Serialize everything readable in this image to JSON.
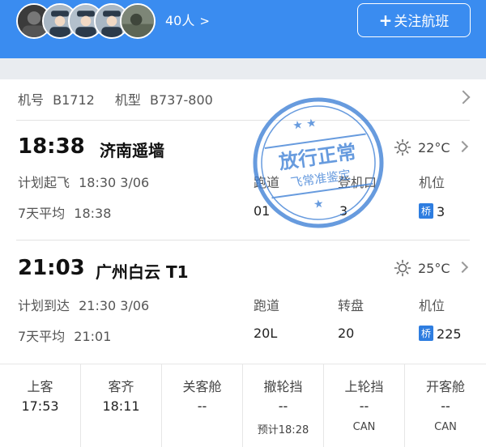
{
  "header": {
    "passenger_count": "40人",
    "passenger_chevron": ">",
    "follow_button_plus": "+",
    "follow_button_label": "关注航班"
  },
  "aircraft": {
    "reg_label": "机号",
    "reg_value": "B1712",
    "type_label": "机型",
    "type_value": "B737-800"
  },
  "departure": {
    "actual_time": "18:38",
    "airport": "济南遥墙",
    "weather_icon": "sun-icon",
    "temperature": "22°C",
    "planned_label": "计划起飞",
    "planned_time": "18:30 3/06",
    "avg_label": "7天平均",
    "avg_time": "18:38",
    "runway_label": "跑道",
    "runway_value": "01",
    "gate_label": "登机口",
    "gate_value": "3",
    "stand_label": "机位",
    "stand_badge": "桥",
    "stand_value": "3"
  },
  "arrival": {
    "actual_time": "21:03",
    "airport": "广州白云 T1",
    "weather_icon": "sun-icon",
    "temperature": "25°C",
    "planned_label": "计划到达",
    "planned_time": "21:30 3/06",
    "avg_label": "7天平均",
    "avg_time": "21:01",
    "runway_label": "跑道",
    "runway_value": "20L",
    "carousel_label": "转盘",
    "carousel_value": "20",
    "stand_label": "机位",
    "stand_badge": "桥",
    "stand_value": "225"
  },
  "stamp": {
    "top_text": "放行正常",
    "bottom_text": "飞常准鉴定",
    "color": "#3d7fd6"
  },
  "stages": [
    {
      "label": "上客",
      "time": "17:53",
      "sub": ""
    },
    {
      "label": "客齐",
      "time": "18:11",
      "sub": ""
    },
    {
      "label": "关客舱",
      "time": "--",
      "sub": ""
    },
    {
      "label": "撤轮挡",
      "time": "--",
      "sub": "预计18:28"
    },
    {
      "label": "上轮挡",
      "time": "--",
      "sub": "CAN"
    },
    {
      "label": "开客舱",
      "time": "--",
      "sub": "CAN"
    }
  ],
  "colors": {
    "header_bg": "#3a8cf0",
    "bridge_badge": "#2e7de0"
  }
}
